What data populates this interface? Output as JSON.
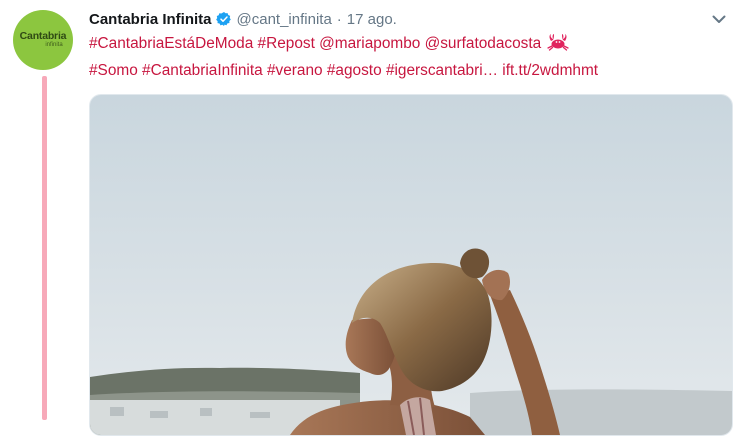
{
  "tweet": {
    "author": {
      "name": "Cantabria Infinita",
      "handle": "@cant_infinita",
      "verified": true,
      "avatar_text_primary": "Cantabria",
      "avatar_text_secondary": "infinita"
    },
    "separator": "·",
    "timestamp": "17 ago.",
    "text_line1": [
      "#CantabriaEstáDeModa",
      "#Repost",
      "@mariapombo",
      "@surfatodacosta"
    ],
    "text_line2": [
      "#Somo",
      "#CantabriaInfinita",
      "#verano",
      "#agosto",
      "#igerscantabri…",
      "ift.tt/2wdmhmt"
    ],
    "emoji": "crab-emoji-icon",
    "media": {
      "type": "photo",
      "description_icon": "photo-icon"
    }
  },
  "colors": {
    "link": "#c7163f",
    "thread_line": "#f7a9b9",
    "avatar_bg": "#8cc63f",
    "muted": "#657786",
    "verified": "#1da1f2"
  },
  "icons": {
    "verified": "verified-badge-icon",
    "caret": "chevron-down-icon"
  }
}
